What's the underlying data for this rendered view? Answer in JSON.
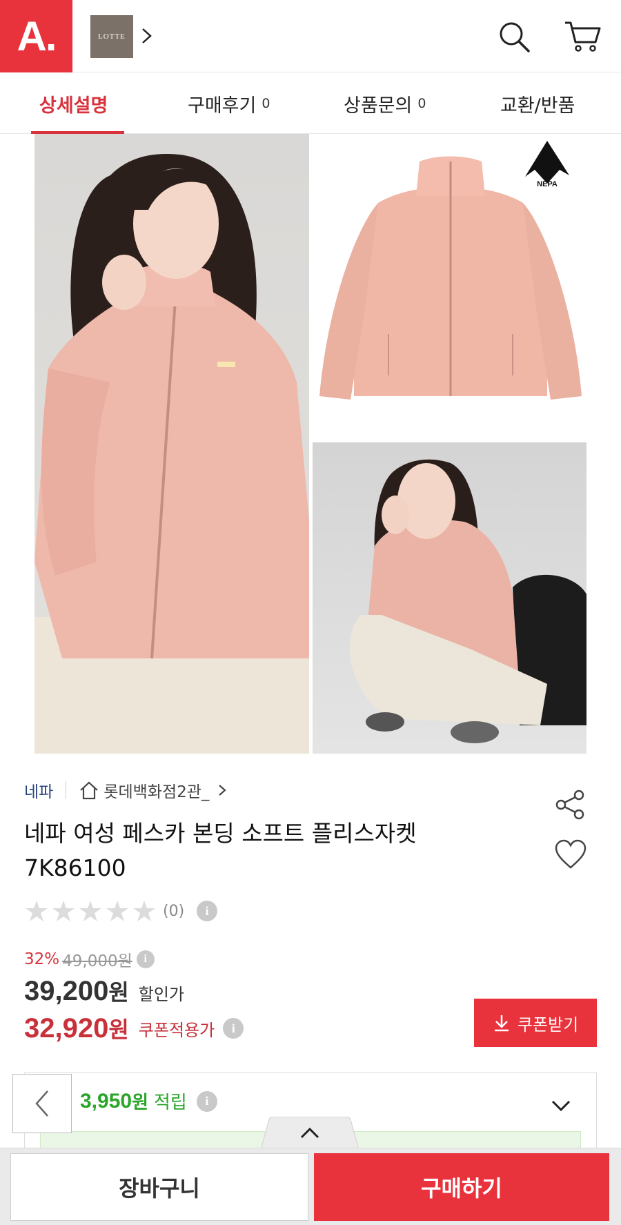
{
  "header": {
    "logo_text": "A.",
    "store_logo_text": "LOTTE",
    "icons": [
      "search-icon",
      "cart-icon",
      "chevron-right-icon"
    ]
  },
  "tabs": [
    {
      "label": "상세설명",
      "count": "",
      "active": true
    },
    {
      "label": "구매후기",
      "count": "0",
      "active": false
    },
    {
      "label": "상품문의",
      "count": "0",
      "active": false
    },
    {
      "label": "교환/반품",
      "count": "",
      "active": false
    }
  ],
  "product_images": {
    "brand_mark": "NEPA",
    "photos": [
      "model-standing",
      "jacket-flat",
      "model-sitting"
    ]
  },
  "product": {
    "brand": "네파",
    "store": "롯데백화점2관_",
    "title_line1": "네파 여성 페스카 본딩 소프트 플리스자켓",
    "title_line2": "7K86100",
    "rating_count": "(0)",
    "rating_value": 0,
    "rating_max": 5
  },
  "pricing": {
    "discount_pct": "32%",
    "original_price": "49,000원",
    "sale_price": "39,200",
    "sale_won": "원",
    "sale_label": "할인가",
    "coupon_price": "32,920",
    "coupon_won": "원",
    "coupon_label": "쿠폰적용가",
    "coupon_button": "쿠폰받기"
  },
  "points": {
    "amount": "3,950",
    "won": "원",
    "label": "적립"
  },
  "bottom_bar": {
    "cart_button": "장바구니",
    "buy_button": "구매하기"
  },
  "colors": {
    "brand_red": "#e8323c",
    "price_red": "#c8303a",
    "point_green": "#2aa52a",
    "brand_navy": "#27467a"
  }
}
